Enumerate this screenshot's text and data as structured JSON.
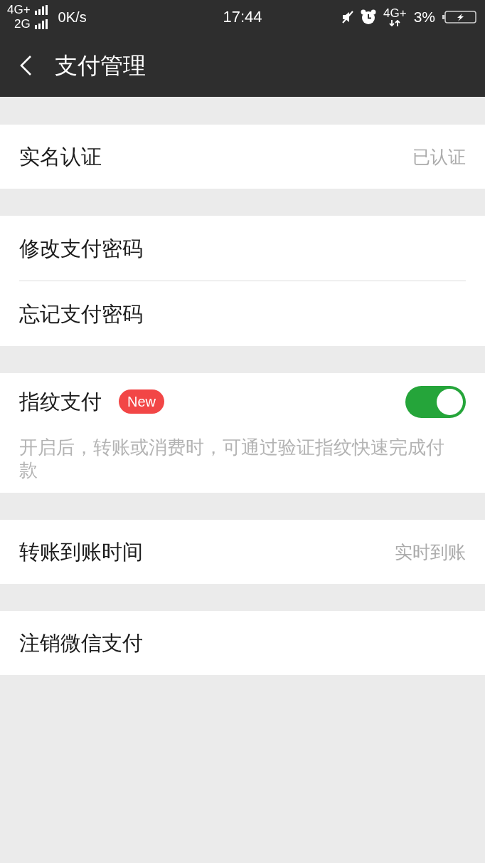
{
  "status_bar": {
    "network_primary": "4G+",
    "network_secondary": "2G",
    "speed": "0K/s",
    "time": "17:44",
    "mobile_data": "4G+",
    "battery": "3%"
  },
  "header": {
    "title": "支付管理"
  },
  "groups": [
    {
      "items": [
        {
          "kind": "value",
          "label": "实名认证",
          "value": "已认证"
        }
      ]
    },
    {
      "items": [
        {
          "kind": "plain",
          "label": "修改支付密码"
        },
        {
          "kind": "plain",
          "label": "忘记支付密码"
        }
      ]
    },
    {
      "items": [
        {
          "kind": "toggle",
          "label": "指纹支付",
          "badge": "New",
          "on": true,
          "description": "开启后，转账或消费时，可通过验证指纹快速完成付款"
        }
      ]
    },
    {
      "items": [
        {
          "kind": "value",
          "label": "转账到账时间",
          "value": "实时到账"
        }
      ]
    },
    {
      "items": [
        {
          "kind": "plain",
          "label": "注销微信支付"
        }
      ]
    }
  ]
}
